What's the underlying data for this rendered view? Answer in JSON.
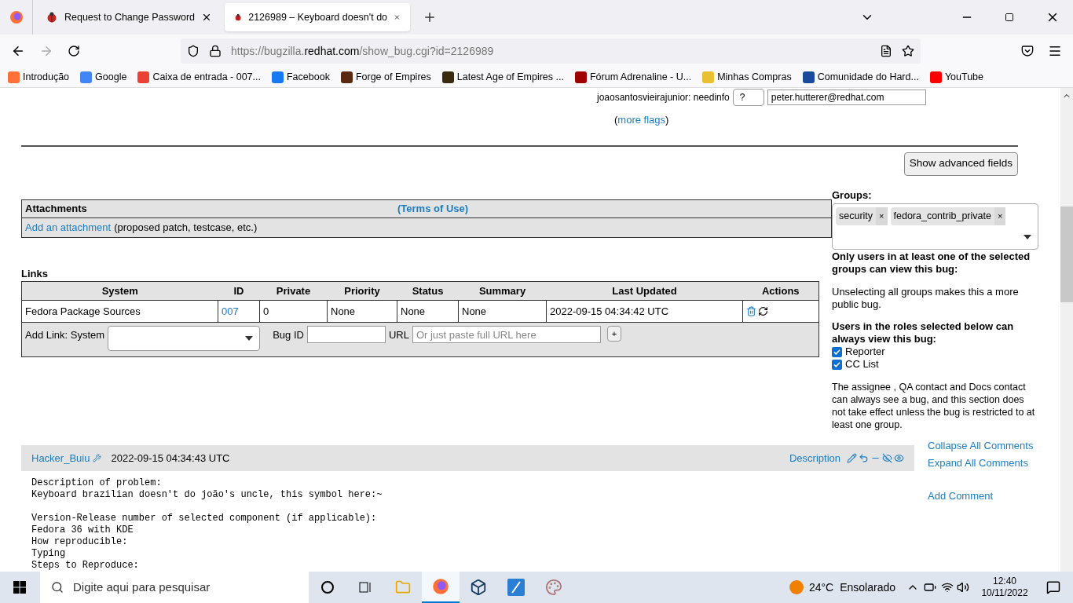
{
  "browser": {
    "tabs": [
      {
        "title": "Request to Change Password",
        "selected": false
      },
      {
        "title": "2126989 – Keyboard doesn't do",
        "selected": true
      }
    ],
    "url": {
      "prefix": "https://bugzilla.",
      "domain": "redhat.com",
      "path": "/show_bug.cgi?id=2126989"
    },
    "bookmarks": [
      {
        "label": "Introdução"
      },
      {
        "label": "Google"
      },
      {
        "label": "Caixa de entrada - 007..."
      },
      {
        "label": "Facebook"
      },
      {
        "label": "Forge of Empires"
      },
      {
        "label": "Latest Age of Empires ..."
      },
      {
        "label": "Fórum Adrenaline - U..."
      },
      {
        "label": "Minhas Compras"
      },
      {
        "label": "Comunidade do Hard..."
      },
      {
        "label": "YouTube"
      }
    ]
  },
  "flag_row": {
    "setter": "joaosantosvieirajunior: needinfo",
    "status": "?",
    "requestee": "peter.hutterer@redhat.com"
  },
  "more_flags": {
    "open": "(",
    "link": "more flags",
    "close": ")"
  },
  "show_advanced_button": "Show advanced fields",
  "attachments": {
    "title": "Attachments",
    "terms": "(Terms of Use)",
    "add_link": "Add an attachment",
    "add_hint": "(proposed patch, testcase, etc.)"
  },
  "links": {
    "title": "Links",
    "columns": [
      "System",
      "ID",
      "Private",
      "Priority",
      "Status",
      "Summary",
      "Last Updated",
      "Actions"
    ],
    "rows": [
      {
        "system": "Fedora Package Sources",
        "id": "007",
        "private": "0",
        "priority": "None",
        "status": "None",
        "summary": "None",
        "updated": "2022-09-15 04:34:42 UTC"
      }
    ],
    "add_label": "Add Link: System",
    "bug_id_label": "Bug ID",
    "url_label": "URL",
    "url_placeholder": "Or just paste full URL here",
    "add_button": "+"
  },
  "groups": {
    "title": "Groups:",
    "tags": [
      {
        "label": "security",
        "remove": "×"
      },
      {
        "label": "fedora_contrib_private",
        "remove": "×"
      }
    ],
    "only_users": "Only users in at least one of the selected groups can view this bug:",
    "unselecting": "Unselecting all groups makes this a more public bug.",
    "roles_title": "Users in the roles selected below can always view this bug:",
    "roles": [
      {
        "label": "Reporter",
        "checked": true
      },
      {
        "label": "CC List",
        "checked": true
      }
    ],
    "note": "The assignee , QA contact and Docs contact can always see a bug, and this section does not take effect unless the bug is restricted to at least one group."
  },
  "comment": {
    "author": "Hacker_Buiu",
    "time": "2022-09-15 04:34:43 UTC",
    "label": "Description",
    "paragraphs": [
      [
        "Description of problem:",
        "Keyboard brazilian doesn't do joão's uncle, this symbol here:~"
      ],
      [
        "Version-Release number of selected component (if applicable):",
        "Fedora 36 with KDE",
        "How reproducible:",
        "Typing",
        "Steps to Reproduce:"
      ]
    ]
  },
  "comment_actions": [
    "Collapse All Comments",
    "Expand All Comments",
    "Add Comment"
  ],
  "taskbar": {
    "search_placeholder": "Digite aqui para pesquisar",
    "apps": [
      {
        "kind": "cortana",
        "active": false
      },
      {
        "kind": "taskview",
        "active": false
      },
      {
        "kind": "explorer",
        "active": false
      },
      {
        "kind": "firefox",
        "active": true
      },
      {
        "kind": "virtualbox",
        "active": false
      },
      {
        "kind": "c4",
        "active": false
      },
      {
        "kind": "paint",
        "active": false
      }
    ],
    "temp": "24°C",
    "weather": "Ensolarado",
    "time": "12:40",
    "date": "10/11/2022"
  }
}
